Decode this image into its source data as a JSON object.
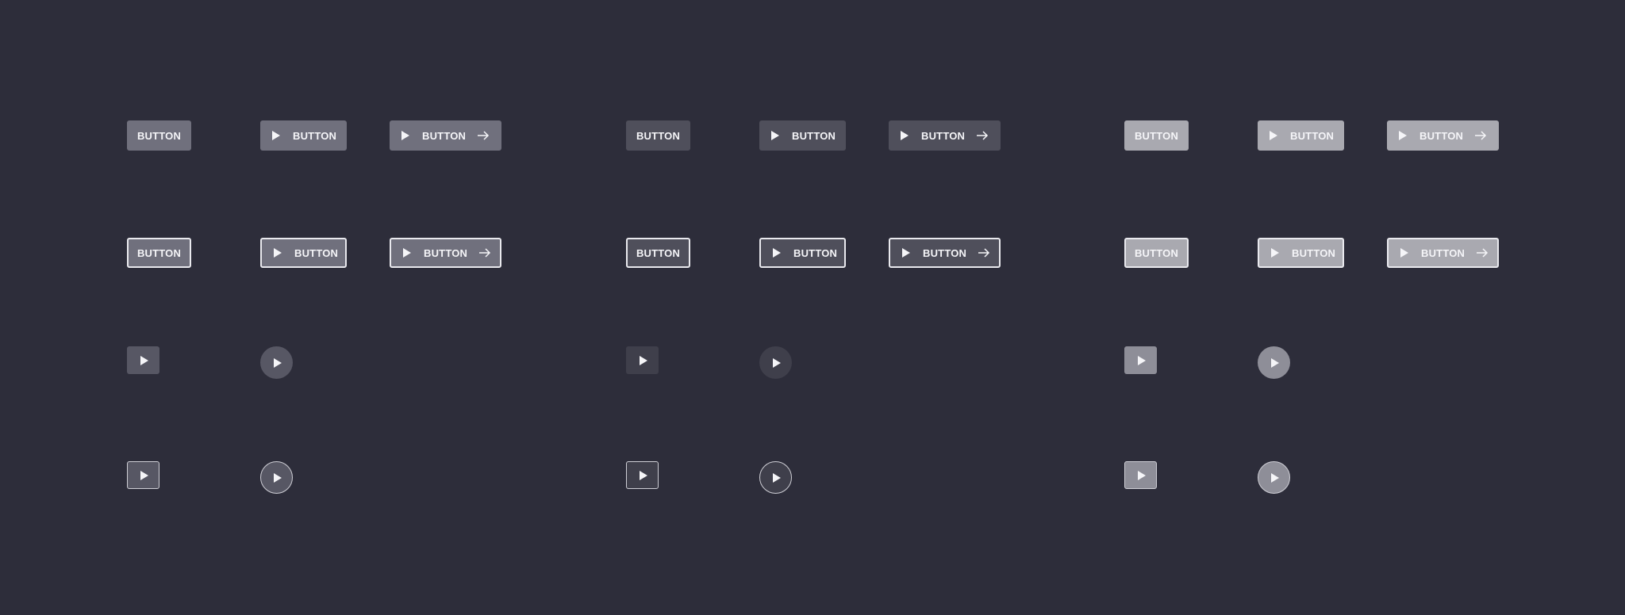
{
  "buttons": {
    "label": "BUTTON"
  },
  "colors": {
    "background": "#2d2d3a",
    "variant_1": "#70707d",
    "variant_2": "#4f4f5b",
    "variant_3": "#a9a9b0",
    "outline": "#e9e9ee",
    "icon_variant_1": "#575764",
    "icon_variant_2": "#3f3f4b",
    "icon_variant_3": "#8e8e98"
  },
  "icons": {
    "play": "play-icon",
    "arrow": "arrow-right-icon"
  }
}
